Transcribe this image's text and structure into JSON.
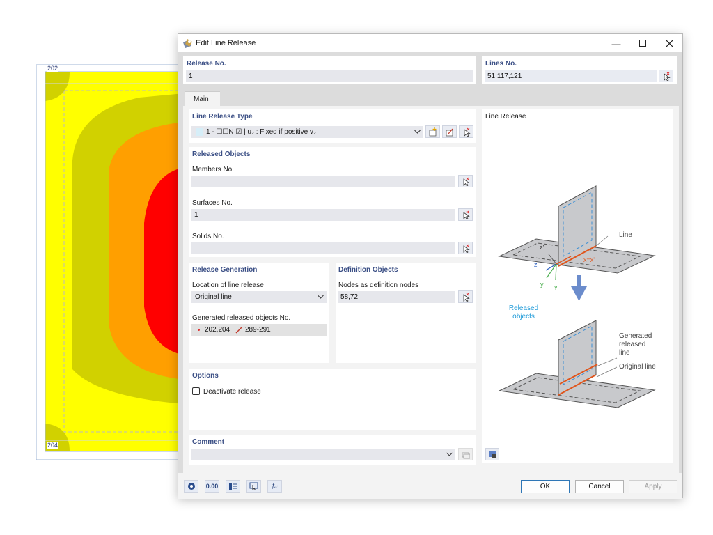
{
  "background": {
    "node_top": "202",
    "node_bottom": "204",
    "contour_colors": [
      "#d1d100",
      "#ffff00",
      "#ff9f00",
      "#ff0000"
    ]
  },
  "dialog": {
    "title": "Edit Line Release",
    "release_no": {
      "label": "Release No.",
      "value": "1"
    },
    "lines_no": {
      "label": "Lines No.",
      "value": "51,117,121"
    },
    "tabs": [
      {
        "label": "Main"
      }
    ],
    "line_release_type": {
      "title": "Line Release Type",
      "value": "1 - ☐☐N ☑ | u₂ : Fixed if positive v₂"
    },
    "released_objects": {
      "title": "Released Objects",
      "members": {
        "label": "Members No.",
        "value": ""
      },
      "surfaces": {
        "label": "Surfaces No.",
        "value": "1"
      },
      "solids": {
        "label": "Solids No.",
        "value": ""
      }
    },
    "release_generation": {
      "title": "Release Generation",
      "location_label": "Location of line release",
      "location_value": "Original line",
      "generated_label": "Generated released objects No.",
      "generated_nodes": "202,204",
      "generated_lines": "289-291"
    },
    "definition_objects": {
      "title": "Definition Objects",
      "nodes_label": "Nodes as definition nodes",
      "nodes_value": "58,72"
    },
    "options": {
      "title": "Options",
      "deactivate_label": "Deactivate release",
      "deactivate_checked": false
    },
    "comment": {
      "label": "Comment",
      "value": ""
    },
    "illustration": {
      "title": "Line Release",
      "label_line": "Line",
      "label_released_objects_1": "Released",
      "label_released_objects_2": "objects",
      "label_generated_1": "Generated",
      "label_generated_2": "released",
      "label_generated_3": "line",
      "label_original": "Original line",
      "axis_z_prime": "z'",
      "axis_z": "z",
      "axis_y_prime": "y'",
      "axis_y": "y",
      "axis_x": "x=x'"
    },
    "footer": {
      "tool_value": "0.00",
      "ok": "OK",
      "cancel": "Cancel",
      "apply": "Apply"
    }
  },
  "colors": {
    "accent_label": "#3b4f85",
    "release_orange": "#e0551c",
    "arrow_blue": "#6b8ccc",
    "released_text_blue": "#1e9ad8"
  }
}
